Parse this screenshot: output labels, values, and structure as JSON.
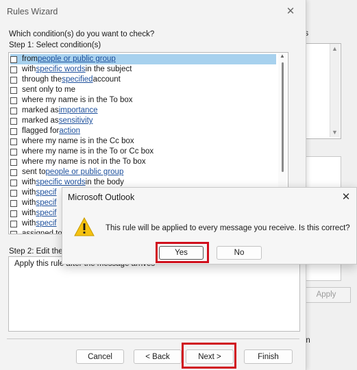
{
  "background": {
    "frag_ns": "ns",
    "frag_en": "en",
    "apply_label": "Apply"
  },
  "wizard": {
    "title": "Rules Wizard",
    "question": "Which condition(s) do you want to check?",
    "step1": "Step 1: Select condition(s)",
    "conditions": [
      {
        "pre": "from ",
        "link": "people or public group",
        "post": ""
      },
      {
        "pre": "with ",
        "link": "specific words",
        "post": " in the subject"
      },
      {
        "pre": "through the ",
        "link": "specified",
        "post": " account"
      },
      {
        "pre": "sent only to me",
        "link": "",
        "post": ""
      },
      {
        "pre": "where my name is in the To box",
        "link": "",
        "post": ""
      },
      {
        "pre": "marked as ",
        "link": "importance",
        "post": ""
      },
      {
        "pre": "marked as ",
        "link": "sensitivity",
        "post": ""
      },
      {
        "pre": "flagged for ",
        "link": "action",
        "post": ""
      },
      {
        "pre": "where my name is in the Cc box",
        "link": "",
        "post": ""
      },
      {
        "pre": "where my name is in the To or Cc box",
        "link": "",
        "post": ""
      },
      {
        "pre": "where my name is not in the To box",
        "link": "",
        "post": ""
      },
      {
        "pre": "sent to ",
        "link": "people or public group",
        "post": ""
      },
      {
        "pre": "with ",
        "link": "specific words",
        "post": " in the body"
      },
      {
        "pre": "with ",
        "link": "specif",
        "post": ""
      },
      {
        "pre": "with ",
        "link": "specif",
        "post": ""
      },
      {
        "pre": "with ",
        "link": "specif",
        "post": ""
      },
      {
        "pre": "with ",
        "link": "specif",
        "post": ""
      },
      {
        "pre": "assigned to",
        "link": "",
        "post": ""
      }
    ],
    "step2": "Step 2: Edit the",
    "description": "Apply this rule after the message arrives",
    "buttons": {
      "cancel": "Cancel",
      "back": "< Back",
      "next": "Next >",
      "finish": "Finish"
    }
  },
  "confirm": {
    "title": "Microsoft Outlook",
    "message": "This rule will be applied to every message you receive. Is this correct?",
    "yes": "Yes",
    "no": "No",
    "icon": "warning-icon"
  },
  "colors": {
    "highlight": "#d00f1c",
    "selection": "#a7d1ee",
    "link": "#1c4f9c"
  }
}
